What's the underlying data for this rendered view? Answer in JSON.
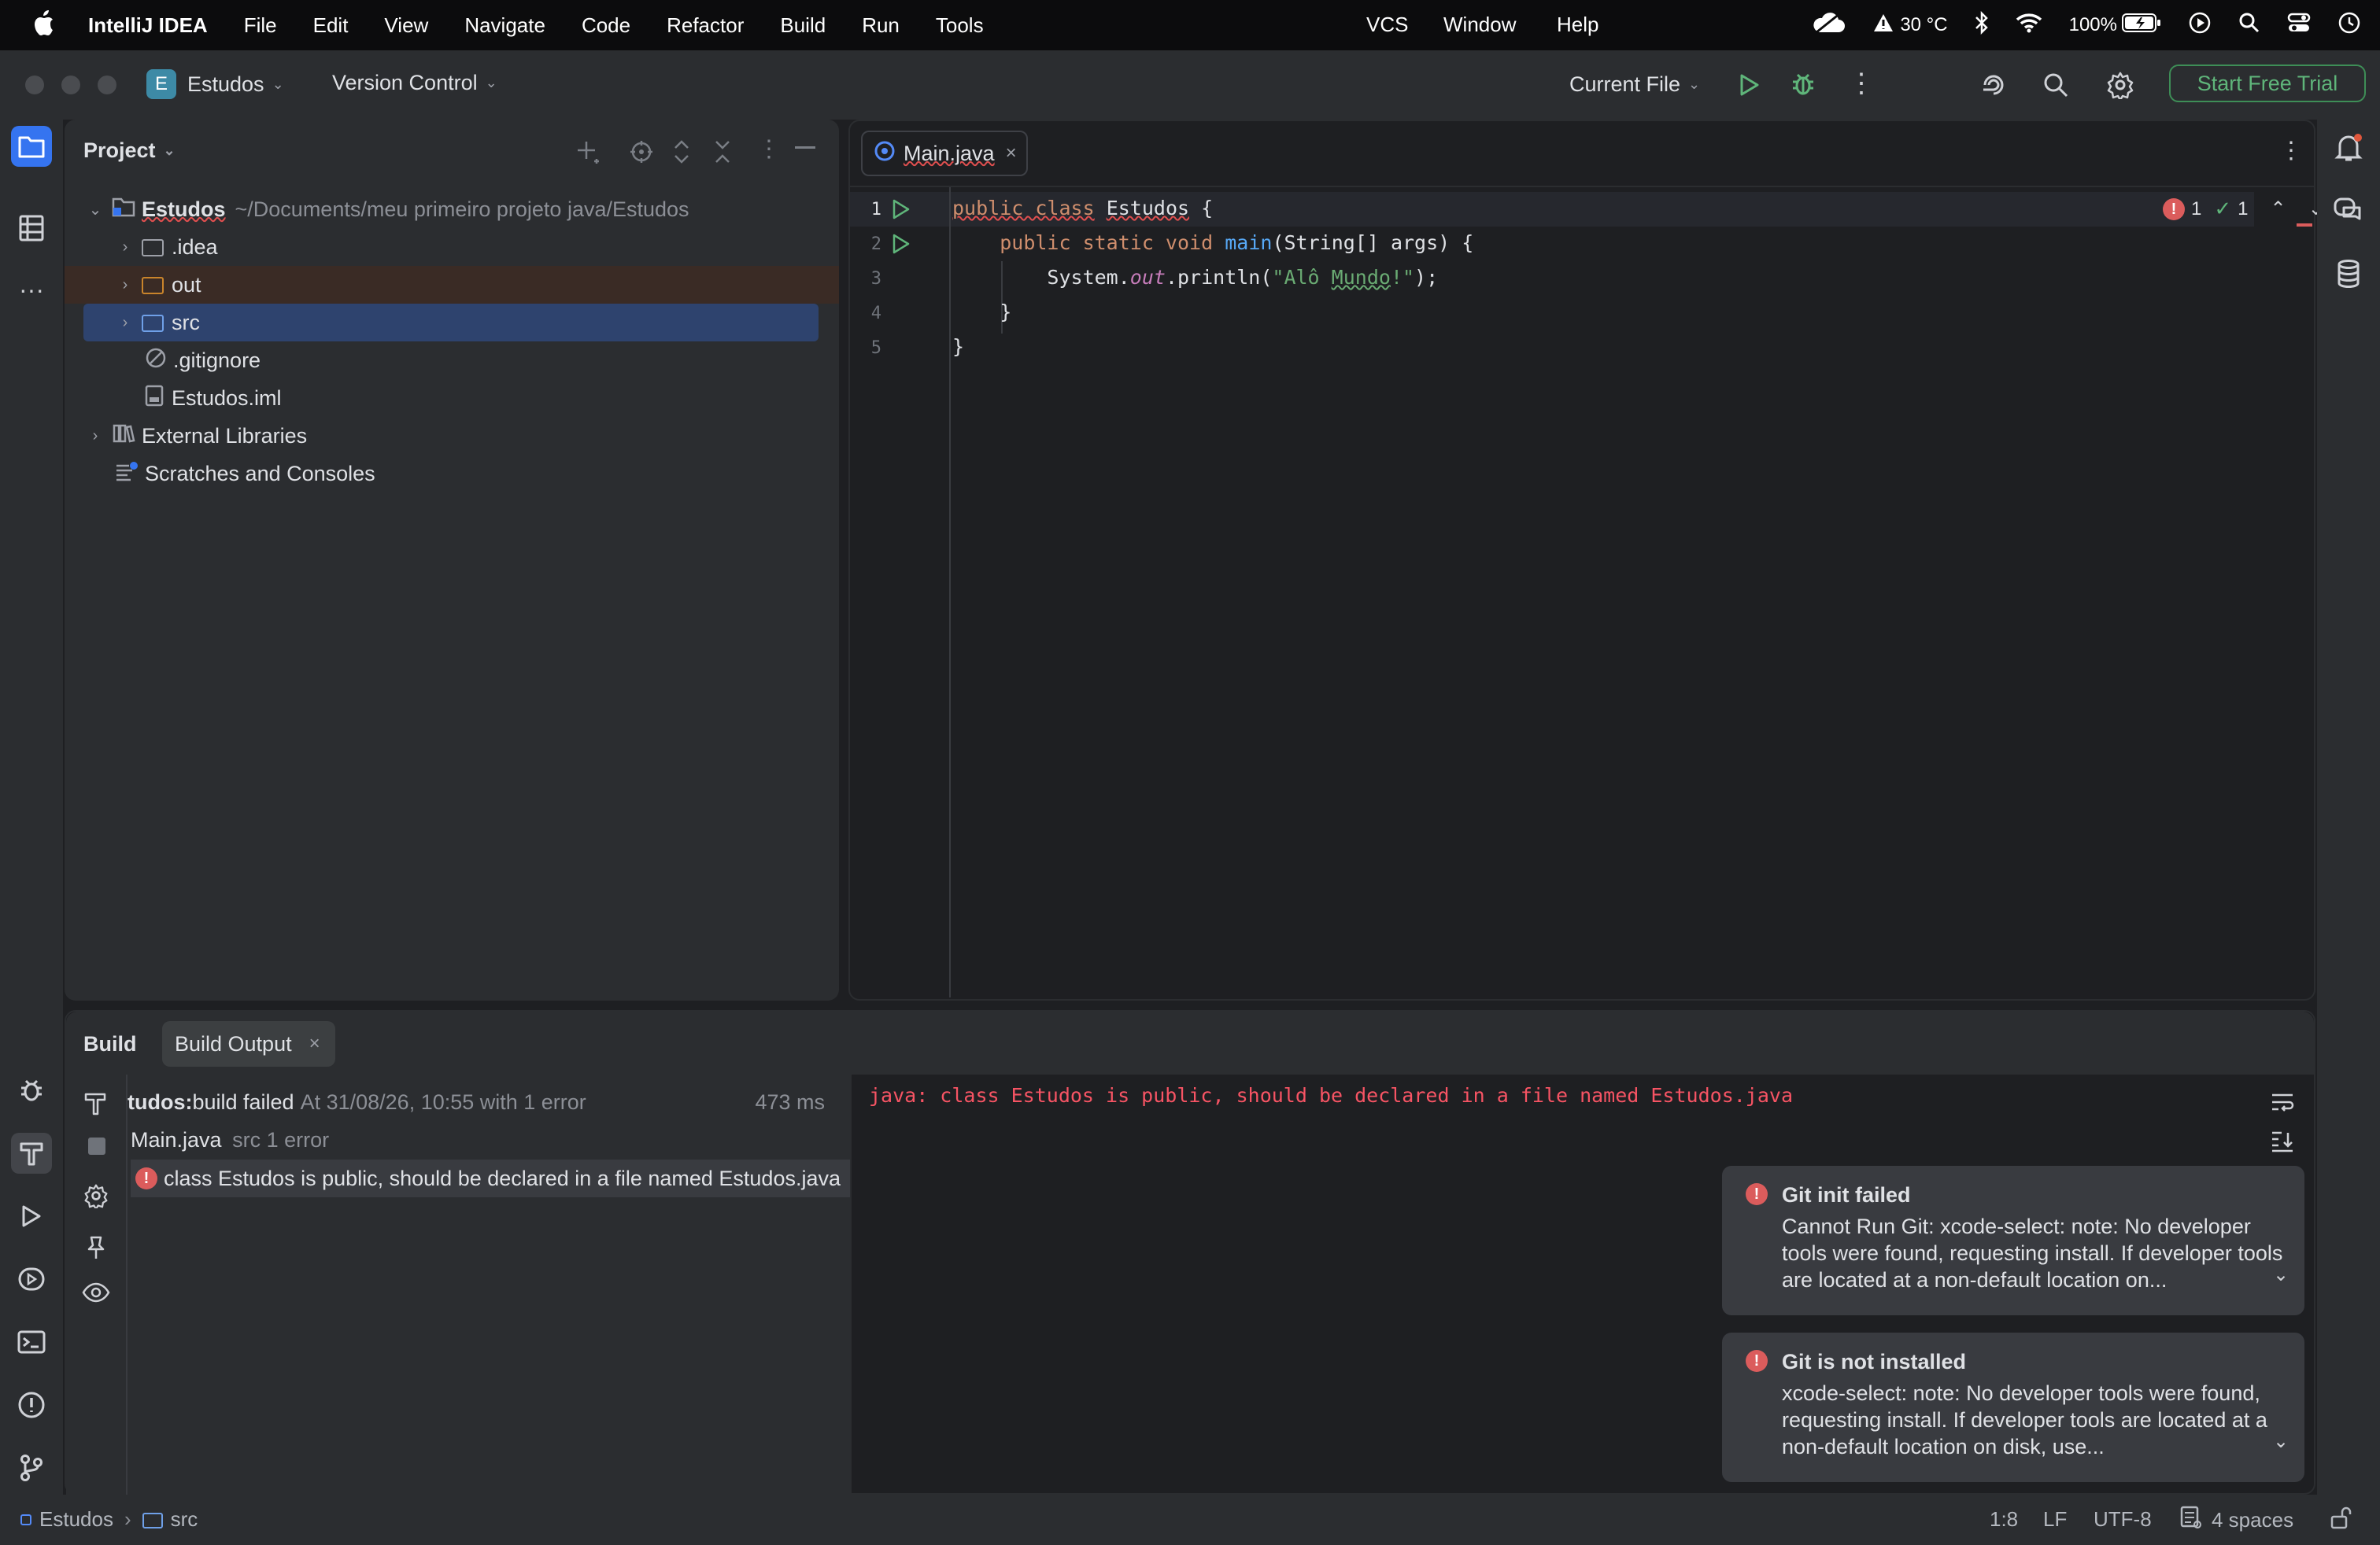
{
  "menubar": {
    "app": "IntelliJ IDEA",
    "items": [
      "File",
      "Edit",
      "View",
      "Navigate",
      "Code",
      "Refactor",
      "Build",
      "Run",
      "Tools",
      "VCS",
      "Window",
      "Help"
    ],
    "temp": "30 °C",
    "battery": "100%"
  },
  "titlebar": {
    "project_badge": "E",
    "project": "Estudos",
    "vcs": "Version Control",
    "run_config": "Current File",
    "trial": "Start Free Trial"
  },
  "project_panel": {
    "title": "Project",
    "root_name": "Estudos",
    "root_path": "~/Documents/meu primeiro projeto java/Estudos",
    "nodes": [
      ".idea",
      "out",
      "src",
      ".gitignore",
      "Estudos.iml",
      "External Libraries",
      "Scratches and Consoles"
    ]
  },
  "editor": {
    "tab": "Main.java",
    "error_count": "1",
    "ok_count": "1",
    "line_numbers": [
      "1",
      "2",
      "3",
      "4",
      "5"
    ],
    "code": {
      "l1_kw": "public class",
      "l1_name": "Estudos",
      "l1_rest": " {",
      "l2_kw": "public static void",
      "l2_fn": "main",
      "l2_rest": "(String[] args) {",
      "l3_a": "System.",
      "l3_it": "out",
      "l3_b": ".println(",
      "l3_str_a": "\"Alô ",
      "l3_str_b": "Mundo",
      "l3_str_c": "!\"",
      "l3_c": ");",
      "l4": "}",
      "l5": "}"
    }
  },
  "build": {
    "title": "Build",
    "tab": "Build Output",
    "summary_bold": "tudos:",
    "summary_rest": " build failed",
    "summary_time": "At 31/08/26, 10:55 with 1 error",
    "duration": "473 ms",
    "file": "Main.java",
    "file_detail": "src 1 error",
    "error_item": "class Estudos is public, should be declared in a file named Estudos.java",
    "output": "java: class Estudos is public, should be declared in a file named Estudos.java"
  },
  "notifications": [
    {
      "title": "Git init failed",
      "text": "Cannot Run Git: xcode-select: note: No developer tools were found, requesting install. If developer tools are located at a non-default location on..."
    },
    {
      "title": "Git is not installed",
      "text": "xcode-select: note: No developer tools were found, requesting install. If developer tools are located at a non-default location on disk, use..."
    }
  ],
  "statusbar": {
    "crumb1": "Estudos",
    "crumb2": "src",
    "position": "1:8",
    "line_sep": "LF",
    "encoding": "UTF-8",
    "indent": "4 spaces"
  },
  "colors": {
    "accent": "#3574f0",
    "error": "#db5c5c",
    "trial": "#5fb57a",
    "selection": "#2e436e"
  }
}
